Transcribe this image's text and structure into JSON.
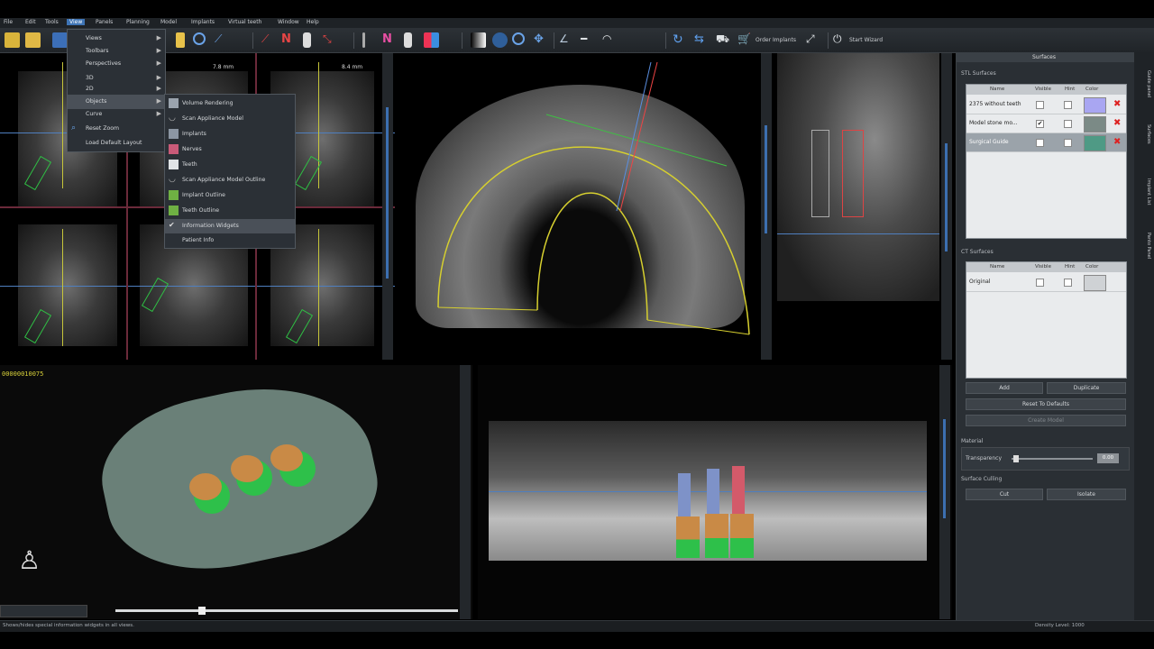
{
  "menubar": {
    "items": [
      "File",
      "Edit",
      "Tools",
      "View",
      "Panels",
      "Planning",
      "Model",
      "Implants",
      "Virtual teeth",
      "Window",
      "Help"
    ]
  },
  "toolbar": {
    "order_implants_label": "Order Implants",
    "start_wizard_label": "Start Wizard"
  },
  "view_menu": {
    "items": [
      "Views",
      "Toolbars",
      "Perspectives",
      "3D",
      "2D",
      "Objects",
      "Curve",
      "Reset Zoom",
      "Load Default Layout"
    ]
  },
  "objects_submenu": {
    "items": [
      {
        "label": "Volume Rendering",
        "icon": "volume-icon"
      },
      {
        "label": "Scan Appliance Model",
        "icon": "scan-appliance-icon"
      },
      {
        "label": "Implants",
        "icon": "implant-icon"
      },
      {
        "label": "Nerves",
        "icon": "nerve-icon"
      },
      {
        "label": "Teeth",
        "icon": "tooth-icon"
      },
      {
        "label": "Scan Appliance Model Outline",
        "icon": "outline-icon"
      },
      {
        "label": "Implant Outline",
        "icon": "implant-outline-icon"
      },
      {
        "label": "Teeth Outline",
        "icon": "teeth-outline-icon"
      },
      {
        "label": "Information Widgets",
        "icon": "check-icon"
      },
      {
        "label": "Patient Info",
        "icon": ""
      }
    ]
  },
  "viewports": {
    "cross_section_labels": [
      "7.8 mm",
      "8.4 mm"
    ],
    "volume_id": "00000010075"
  },
  "panel": {
    "title": "Surfaces",
    "stl_section": "STL Surfaces",
    "ct_section": "CT Surfaces",
    "columns": [
      "Name",
      "Visible",
      "Hint",
      "Color"
    ],
    "stl_rows": [
      {
        "name": "2375 without teeth",
        "visible": false,
        "color": "#a9a6f2"
      },
      {
        "name": "Model stone mo...",
        "visible": true,
        "color": "#7b8a86"
      },
      {
        "name": "Surgical Guide",
        "visible": false,
        "color": "#4f9a85"
      }
    ],
    "ct_rows": [
      {
        "name": "Original",
        "visible": false,
        "color": "#cfd2d5"
      }
    ],
    "buttons": {
      "add": "Add",
      "duplicate": "Duplicate",
      "reset": "Reset To Defaults",
      "create_model": "Create Model",
      "cut": "Cut",
      "isolate": "Isolate"
    },
    "material_section": "Material",
    "transparency_label": "Transparency",
    "transparency_value": "0.00",
    "transparency_level": 0.02,
    "culling_section": "Surface Culling"
  },
  "side_tabs": [
    "Guide panel",
    "Surfaces",
    "Implant List",
    "Panto Panel"
  ],
  "status": {
    "message": "Shows/hides special information widgets in all views.",
    "density": "Density Level: 1000"
  }
}
